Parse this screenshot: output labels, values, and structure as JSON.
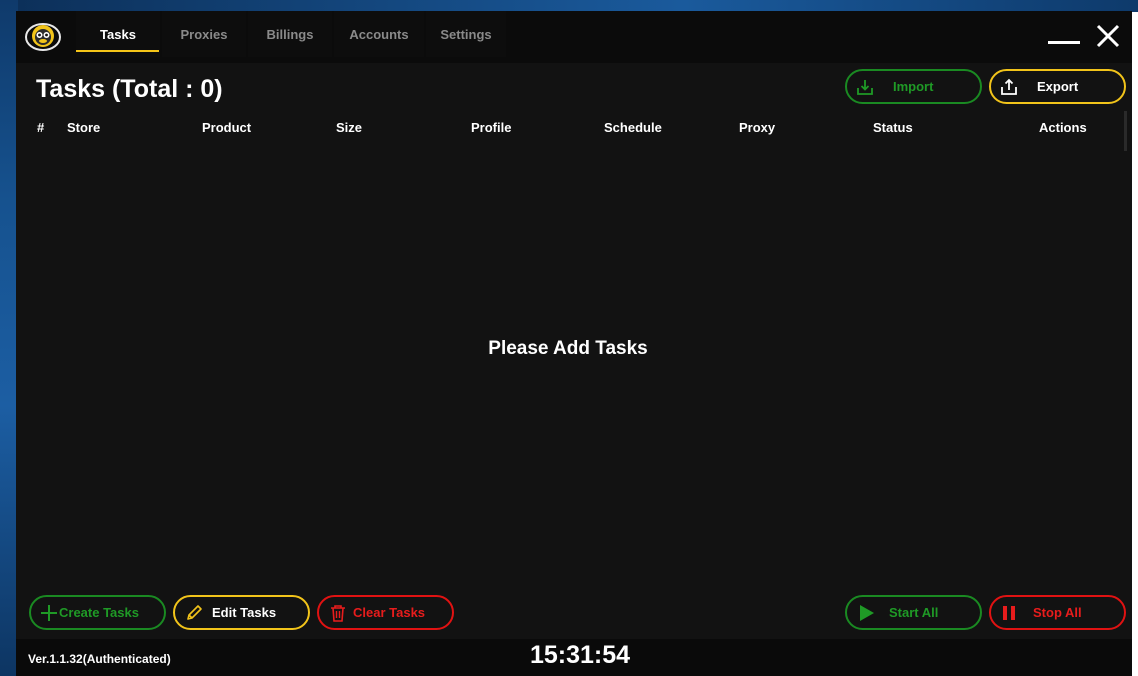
{
  "nav": {
    "tabs": [
      {
        "label": "Tasks",
        "active": true
      },
      {
        "label": "Proxies",
        "active": false
      },
      {
        "label": "Billings",
        "active": false
      },
      {
        "label": "Accounts",
        "active": false
      },
      {
        "label": "Settings",
        "active": false
      }
    ]
  },
  "page": {
    "title": "Tasks (Total : 0)",
    "import_label": "Import",
    "export_label": "Export"
  },
  "table": {
    "columns": [
      "#",
      "Store",
      "Product",
      "Size",
      "Profile",
      "Schedule",
      "Proxy",
      "Status",
      "Actions"
    ],
    "rows": [],
    "empty_message": "Please Add Tasks"
  },
  "actions": {
    "create": "Create Tasks",
    "edit": "Edit Tasks",
    "clear": "Clear Tasks",
    "start": "Start All",
    "stop": "Stop All"
  },
  "status": {
    "version": "Ver.1.1.32(Authenticated)",
    "clock": "15:31:54"
  },
  "colors": {
    "accent_yellow": "#f2c41a",
    "green": "#1a8a22",
    "red": "#e11212",
    "background": "#121212"
  },
  "icons": {
    "logo": "monkey-logo-icon",
    "minimize": "minimize-icon",
    "close": "close-icon",
    "import": "download-tray-icon",
    "export": "upload-tray-icon",
    "create": "plus-icon",
    "edit": "pencil-icon",
    "clear": "trash-icon",
    "start": "play-icon",
    "stop": "pause-icon"
  }
}
